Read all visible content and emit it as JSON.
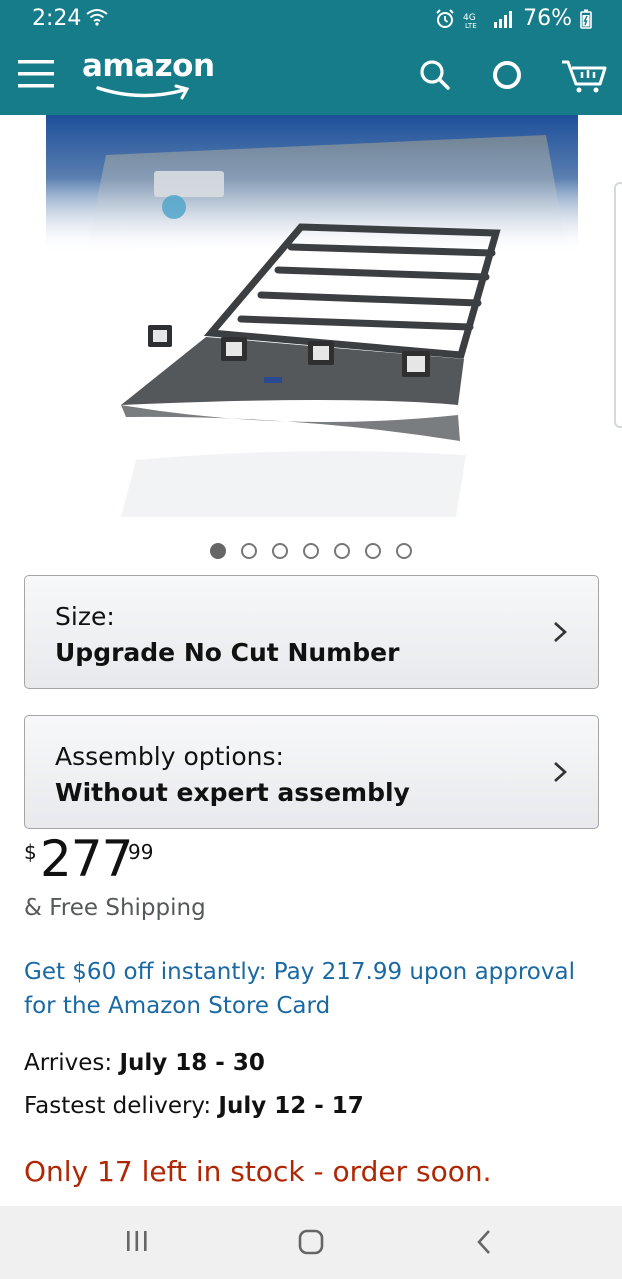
{
  "status_bar": {
    "time": "2:24",
    "battery": "76%",
    "network": "4G LTE"
  },
  "header": {
    "logo_text": "amazon",
    "icons": [
      "menu-icon",
      "search-icon",
      "alexa-icon",
      "cart-icon"
    ]
  },
  "carousel": {
    "total_images": 7,
    "active_index": 0
  },
  "options": [
    {
      "label": "Size:",
      "value": "Upgrade No Cut Number"
    },
    {
      "label": "Assembly options:",
      "value": "Without expert assembly"
    }
  ],
  "price": {
    "symbol": "$",
    "whole": "277",
    "fraction": "99"
  },
  "shipping": "& Free Shipping",
  "promo": "Get $60 off instantly: Pay 217.99 upon approval for the Amazon Store Card",
  "delivery": {
    "arrives_label": "Arrives: ",
    "arrives_value": "July 18 - 30",
    "fastest_label": "Fastest delivery: ",
    "fastest_value": "July 12 - 17"
  },
  "stock_message": "Only 17 left in stock - order soon.",
  "colors": {
    "header": "#177c8a",
    "link": "#1a69a3",
    "stock": "#b12704"
  }
}
